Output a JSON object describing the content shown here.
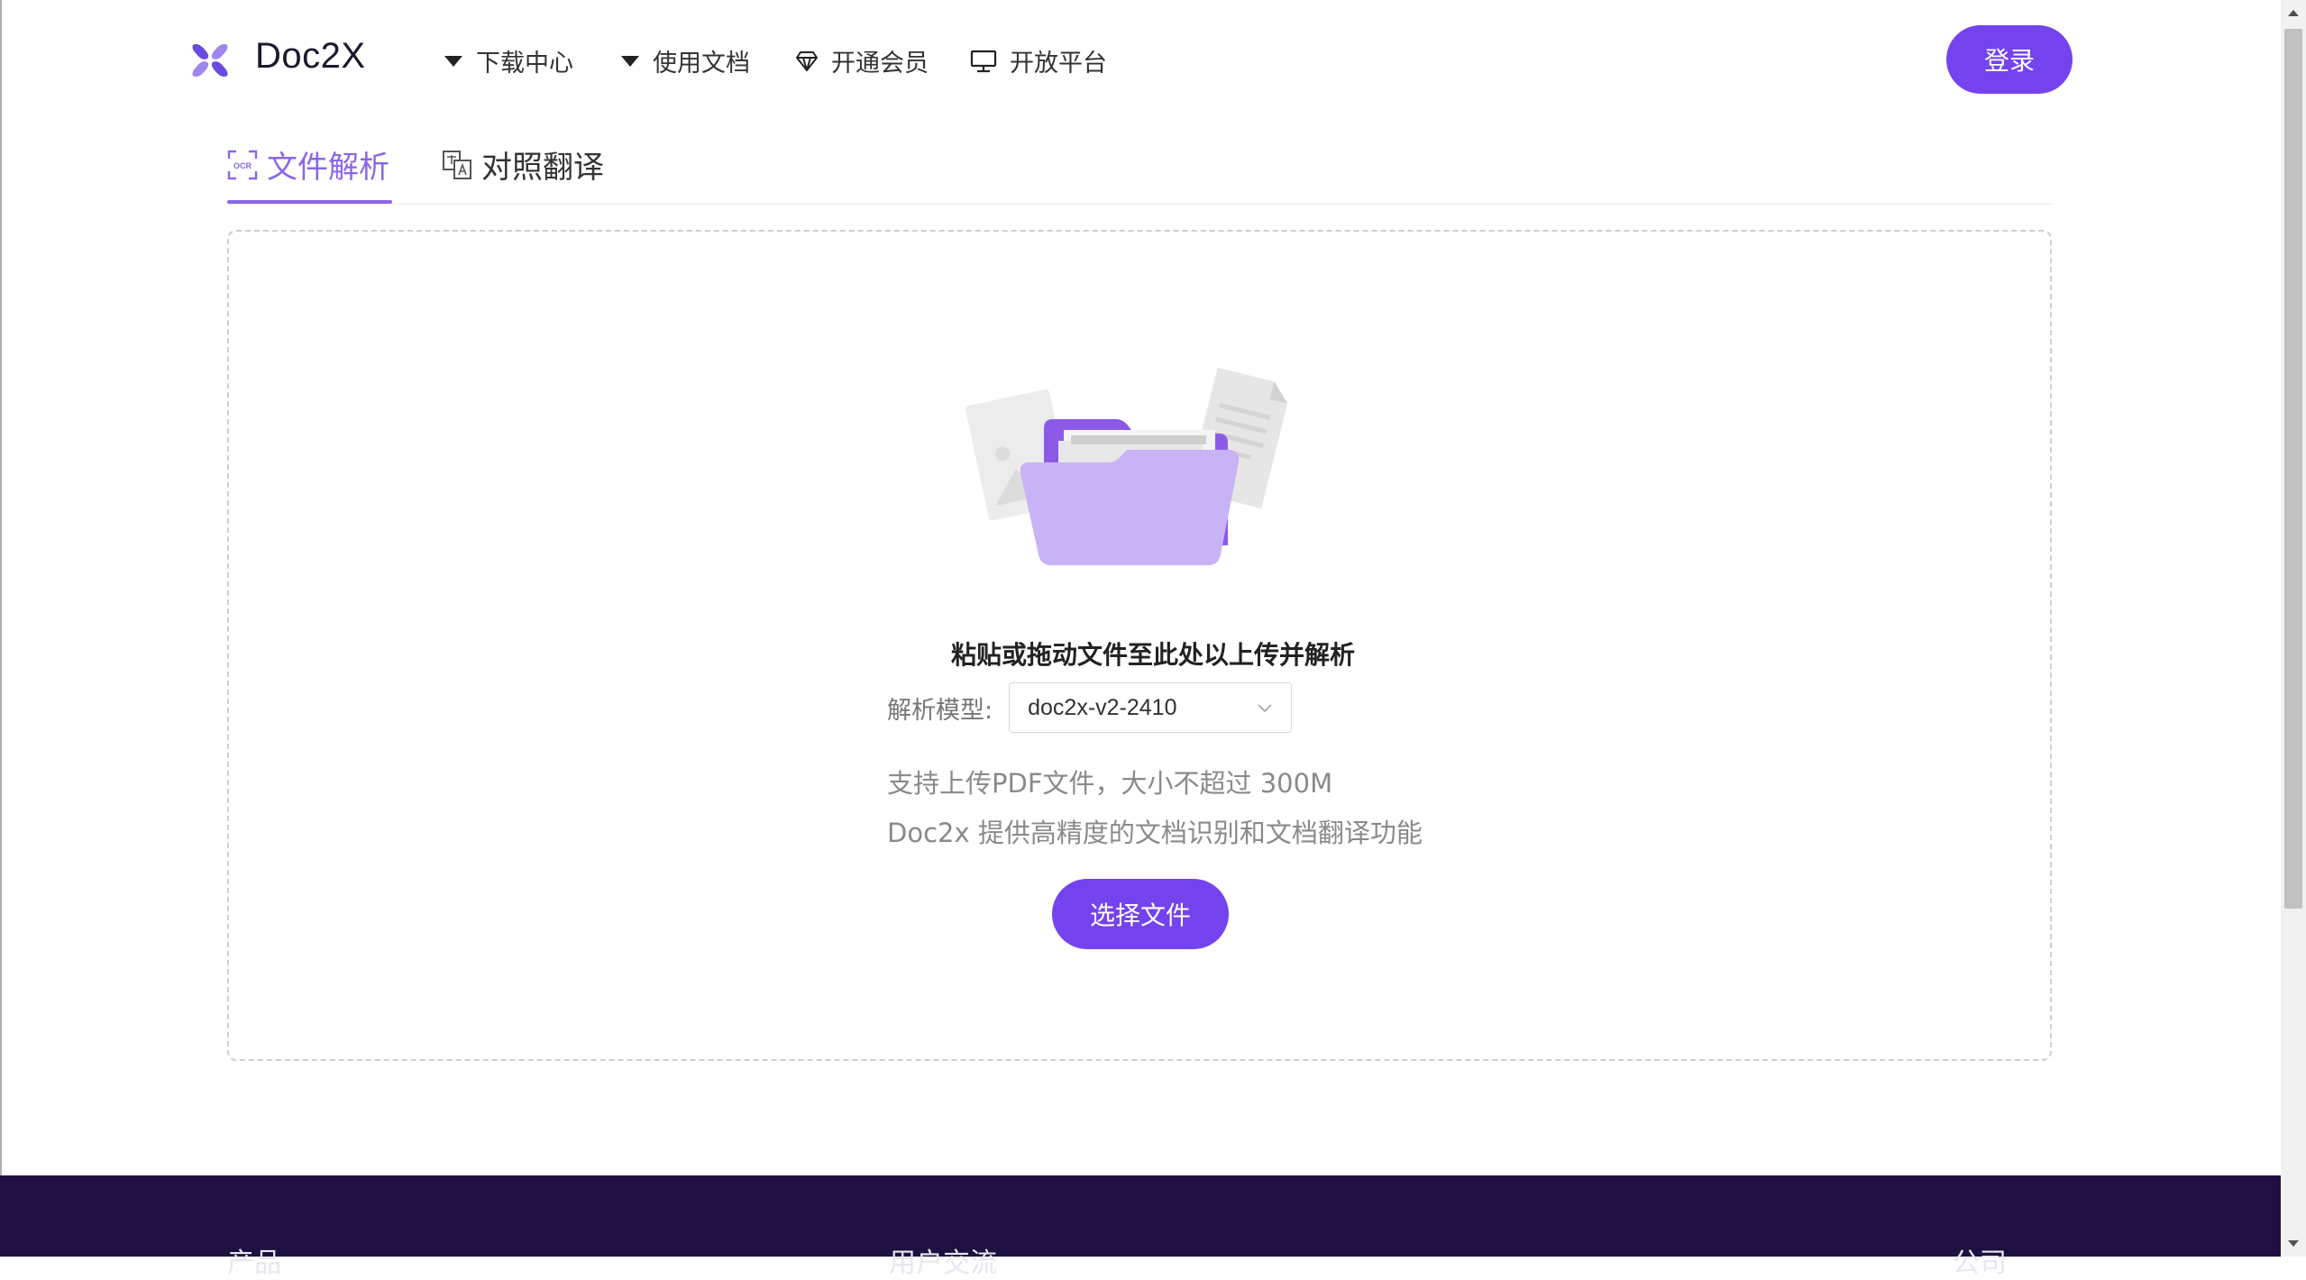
{
  "header": {
    "logo_text": "Doc2X",
    "nav": [
      {
        "label": "下载中心",
        "icon": "caret-down-icon"
      },
      {
        "label": "使用文档",
        "icon": "caret-down-icon"
      },
      {
        "label": "开通会员",
        "icon": "diamond-icon"
      },
      {
        "label": "开放平台",
        "icon": "monitor-icon"
      }
    ],
    "login_label": "登录"
  },
  "tabs": [
    {
      "label": "文件解析",
      "icon": "ocr-icon",
      "active": true
    },
    {
      "label": "对照翻译",
      "icon": "translate-icon",
      "active": false
    }
  ],
  "upload": {
    "prompt": "粘贴或拖动文件至此处以上传并解析",
    "model_label": "解析模型:",
    "model_value": "doc2x-v2-2410",
    "hint_size": "支持上传PDF文件，大小不超过 300M",
    "hint_desc": "Doc2x 提供高精度的文档识别和文档翻译功能",
    "choose_label": "选择文件"
  },
  "footer": {
    "headings": [
      "产品",
      "用户交流",
      "公司"
    ]
  },
  "colors": {
    "accent": "#7443ee",
    "tab_active": "#8b67e6",
    "footer_bg": "#1e1040"
  }
}
